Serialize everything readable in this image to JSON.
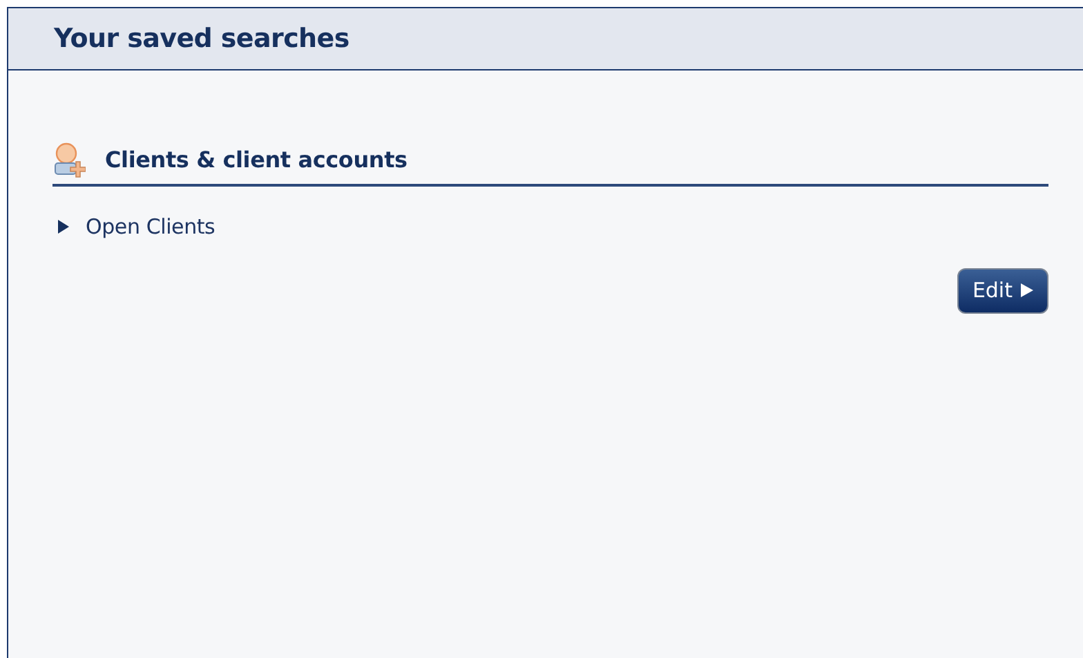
{
  "panel": {
    "title": "Your saved searches"
  },
  "sections": [
    {
      "title": "Clients & client accounts",
      "searches": [
        {
          "label": "Open Clients"
        }
      ]
    }
  ],
  "buttons": [
    {
      "label": "Edit"
    }
  ]
}
